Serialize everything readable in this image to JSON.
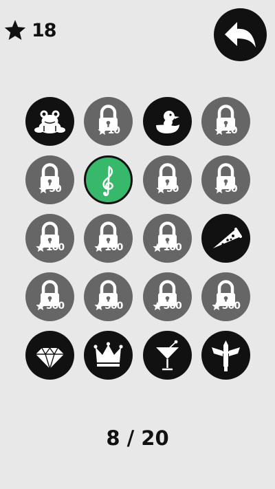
{
  "header": {
    "star_count": "18"
  },
  "grid": {
    "cells": [
      {
        "state": "unlocked",
        "icon": "frog-icon"
      },
      {
        "state": "locked",
        "icon": "padlock-icon",
        "price": "10"
      },
      {
        "state": "unlocked",
        "icon": "duck-icon"
      },
      {
        "state": "locked",
        "icon": "padlock-icon",
        "price": "10"
      },
      {
        "state": "locked",
        "icon": "padlock-icon",
        "price": "50"
      },
      {
        "state": "selected",
        "icon": "treble-clef-icon"
      },
      {
        "state": "locked",
        "icon": "padlock-icon",
        "price": "50"
      },
      {
        "state": "locked",
        "icon": "padlock-icon",
        "price": "50"
      },
      {
        "state": "locked",
        "icon": "padlock-icon",
        "price": "100"
      },
      {
        "state": "locked",
        "icon": "padlock-icon",
        "price": "100"
      },
      {
        "state": "locked",
        "icon": "padlock-icon",
        "price": "100"
      },
      {
        "state": "unlocked",
        "icon": "pizza-icon"
      },
      {
        "state": "locked",
        "icon": "padlock-icon",
        "price": "500"
      },
      {
        "state": "locked",
        "icon": "padlock-icon",
        "price": "500"
      },
      {
        "state": "locked",
        "icon": "padlock-icon",
        "price": "500"
      },
      {
        "state": "locked",
        "icon": "padlock-icon",
        "price": "500"
      },
      {
        "state": "unlocked",
        "icon": "diamond-icon"
      },
      {
        "state": "unlocked",
        "icon": "crown-icon"
      },
      {
        "state": "unlocked",
        "icon": "cocktail-icon"
      },
      {
        "state": "unlocked",
        "icon": "winged-sword-icon"
      }
    ]
  },
  "footer": {
    "progress_text": "8 / 20"
  },
  "colors": {
    "background": "#e8e8e8",
    "locked": "#666666",
    "unlocked": "#111111",
    "selected": "#38b86a"
  }
}
